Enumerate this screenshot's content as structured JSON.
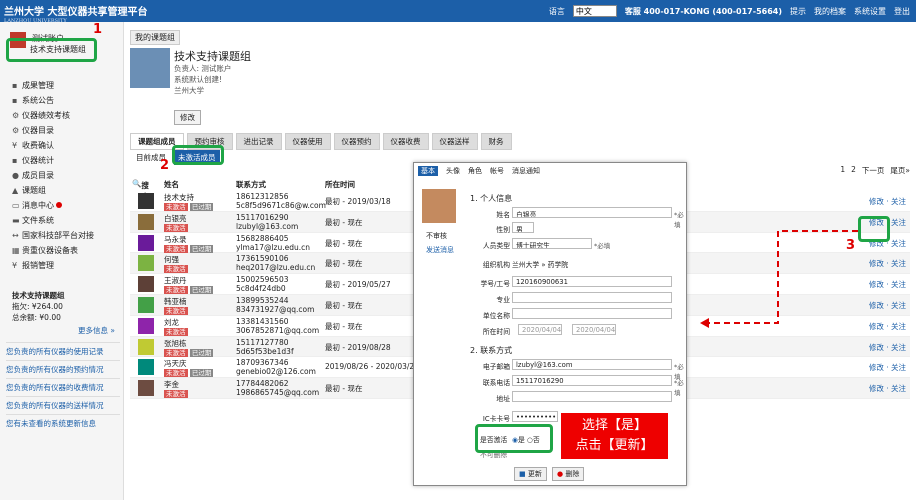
{
  "header": {
    "logo_title": "兰州大学 大型仪器共享管理平台",
    "logo_sub": "LANZHOU UNIVERSITY",
    "lang_label": "语言",
    "lang_value": "中文",
    "service": "客服 400-017-KONG (400-017-5664)",
    "links": [
      "提示",
      "我的档案",
      "系统设置",
      "登出"
    ]
  },
  "sidebar": {
    "user": "测试账户",
    "group": "技术支持课题组",
    "menu": [
      "成果管理",
      "系统公告",
      "仪器绩效考核",
      "仪器目录",
      "收费确认",
      "仪器统计",
      "成员目录",
      "课题组",
      "消息中心",
      "文件系统",
      "国家科技部平台对接",
      "贵重仪器设备表",
      "报销管理"
    ],
    "box_title": "技术支持课题组",
    "box_debt": "拖欠: ¥264.00",
    "box_total": "总余额: ¥0.00",
    "more": "更多信息 »",
    "links": [
      "您负责的所有仪器的使用记录",
      "您负责的所有仪器的预约情况",
      "您负责的所有仪器的收费情况",
      "您负责的所有仪器的送样情况",
      "您有未查看的系统更新信息"
    ]
  },
  "main": {
    "tab": "我的课题组",
    "group_title": "技术支持课题组",
    "owner": "负责人: 测试账户",
    "desc": "系统默认创建!",
    "org": "兰州大学",
    "edit": "修改",
    "tabs": [
      "课题组成员",
      "预约审核",
      "进出记录",
      "仪器使用",
      "仪器预约",
      "仪器收费",
      "仪器送样",
      "财务"
    ],
    "sub_current": "目前成员",
    "sub_inactive": "未激活成员",
    "pager": [
      "1",
      "2",
      "下一页",
      "尾页»"
    ],
    "cols": [
      "搜索",
      "姓名",
      "联系方式",
      "所在时间"
    ],
    "rows": [
      {
        "name": "技术支持",
        "badges": [
          "未激活",
          "已过期"
        ],
        "phone": "18612312856",
        "email": "5c8f5d9671c86@w.com",
        "time": "最初 - 2019/03/18",
        "color": "#333"
      },
      {
        "name": "白银亮",
        "badges": [
          "未激活"
        ],
        "phone": "15117016290",
        "email": "lzubyl@163.com",
        "time": "最初 - 现在",
        "color": "#8a6d3b"
      },
      {
        "name": "马永录",
        "badges": [
          "未激活",
          "已过期"
        ],
        "phone": "15682886405",
        "email": "ylma17@lzu.edu.cn",
        "time": "最初 - 现在",
        "color": "#6a1b9a"
      },
      {
        "name": "何强",
        "badges": [
          "未激活"
        ],
        "phone": "17361590106",
        "email": "heq2017@lzu.edu.cn",
        "time": "最初 - 现在",
        "color": "#7cb342"
      },
      {
        "name": "王淑丹",
        "badges": [
          "未激活",
          "已过期"
        ],
        "phone": "15002596503",
        "email": "5c8d4f24db0",
        "time": "最初 - 2019/05/27",
        "color": "#5d4037"
      },
      {
        "name": "韩亚楠",
        "badges": [
          "未激活"
        ],
        "phone": "13899535244",
        "email": "834731927@qq.com",
        "time": "最初 - 现在",
        "color": "#43a047"
      },
      {
        "name": "刘龙",
        "badges": [
          "未激活"
        ],
        "phone": "13381431560",
        "email": "3067852871@qq.com",
        "time": "最初 - 现在",
        "color": "#8e24aa"
      },
      {
        "name": "张旭栋",
        "badges": [
          "未激活",
          "已过期"
        ],
        "phone": "15117127780",
        "email": "5d65f53be1d3f",
        "time": "最初 - 2019/08/28",
        "color": "#c0ca33"
      },
      {
        "name": "冯天庆",
        "badges": [
          "未激活",
          "已过期"
        ],
        "phone": "18709367346",
        "email": "genebio02@126.com",
        "time": "2019/08/26 - 2020/03/26",
        "color": "#00897b"
      },
      {
        "name": "李金",
        "badges": [
          "未激活"
        ],
        "phone": "17784482062",
        "email": "1986865745@qq.com",
        "time": "最初 - 现在",
        "color": "#6d4c41"
      }
    ],
    "actions": "修改 · 关注"
  },
  "modal": {
    "tabs": [
      "基本",
      "头像",
      "角色",
      "帐号",
      "消息通知"
    ],
    "avatar_label": "不审核",
    "send_msg": "发送消息",
    "sec1": "1. 个人信息",
    "name_l": "姓名",
    "name_v": "白银亮",
    "gender_l": "性别",
    "gender_v": "男",
    "type_l": "人员类型",
    "type_v": "博士研究生",
    "org_l": "组织机构",
    "org_v": "兰州大学 » 药学院",
    "sid_l": "学号/工号",
    "sid_v": "120160900631",
    "major_l": "专业",
    "unit_l": "单位名称",
    "time_l": "所在时间",
    "time_v1": "2020/04/04",
    "time_v2": "2020/04/04",
    "sec2": "2. 联系方式",
    "email_l": "电子邮箱",
    "email_v": "lzubyl@163.com",
    "phone_l": "联系电话",
    "phone_v": "15117016290",
    "addr_l": "地址",
    "card_l": "IC卡卡号",
    "card_v": "••••••••••",
    "active_l": "是否激活",
    "yes": "是",
    "no": "否",
    "hidden_l": "不可删除",
    "req": "*必填",
    "update": "更新",
    "delete": "删除"
  },
  "annotations": {
    "n1": "1",
    "n2": "2",
    "n3": "3",
    "callout1": "选择【是】",
    "callout2": "点击【更新】"
  }
}
